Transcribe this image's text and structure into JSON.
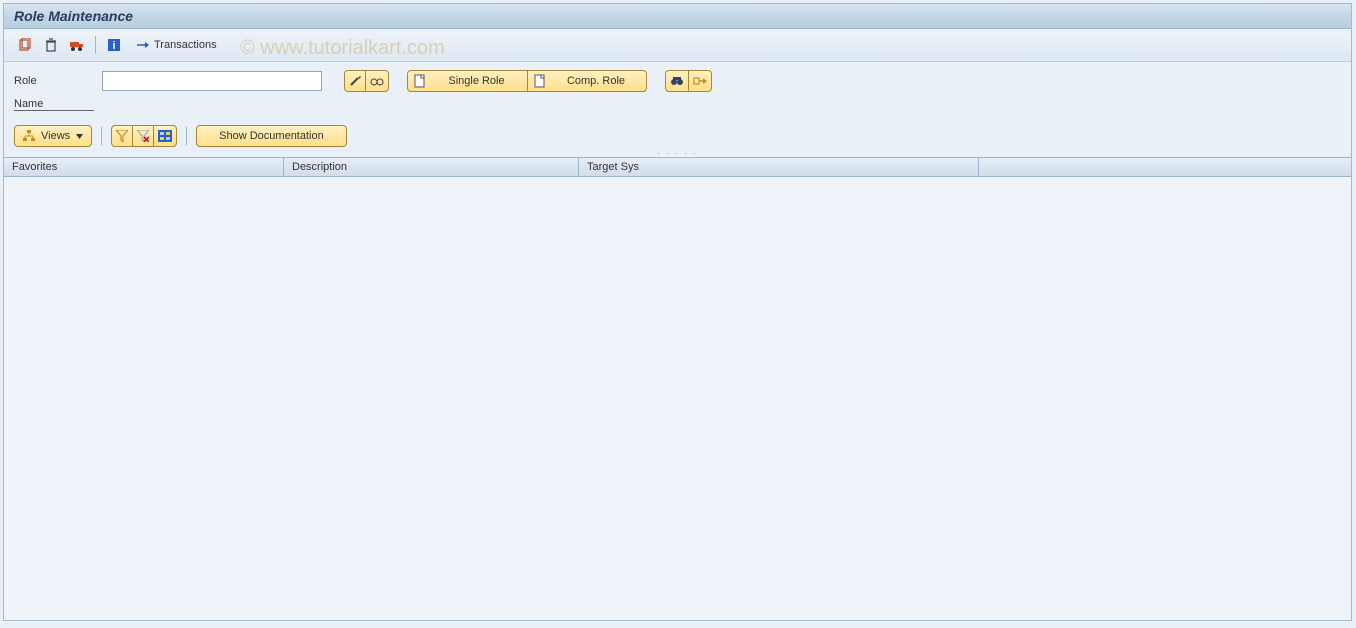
{
  "window": {
    "title": "Role Maintenance"
  },
  "toolbar": {
    "transactions_label": "Transactions"
  },
  "form": {
    "role_label": "Role",
    "role_value": "",
    "name_label": "Name",
    "single_role_btn": "Single Role",
    "comp_role_btn": "Comp. Role"
  },
  "filter": {
    "views_btn": "Views",
    "show_doc_btn": "Show Documentation"
  },
  "table": {
    "col_favorites": "Favorites",
    "col_description": "Description",
    "col_target": "Target Sys"
  },
  "watermark": "© www.tutorialkart.com"
}
